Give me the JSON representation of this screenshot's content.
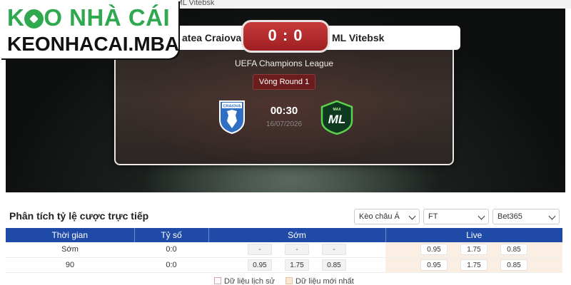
{
  "breadcrumb": "s ML Vitebsk",
  "brand": {
    "line1_prefix": "K",
    "line1_suffix": "O NHÀ CÁI",
    "line2": "KEONHACAI.MBA",
    "color": "#2fa84f"
  },
  "match": {
    "home_team": "atea Craiova",
    "away_team": "ML Vitebsk",
    "score": "0 : 0",
    "league": "UEFA Champions League",
    "round": "Vòng Round 1",
    "time": "00:30",
    "date": "16/07/2026",
    "home_crest_text": "CRAIOVA",
    "away_crest_top": "MAX",
    "away_crest_main": "ML"
  },
  "odds_panel": {
    "title": "Phân tích tỷ lệ cược trực tiếp",
    "filters": [
      "Kèo châu Á",
      "FT",
      "Bet365"
    ],
    "columns": [
      "Thời gian",
      "Tỷ số",
      "Sớm",
      "Live"
    ],
    "rows": [
      {
        "time": "Sớm",
        "score": "0:0",
        "early": [
          "-",
          "-",
          "-"
        ],
        "live": [
          "0.95",
          "1.75",
          "0.85"
        ]
      },
      {
        "time": "90",
        "score": "0:0",
        "early": [
          "0.95",
          "1.75",
          "0.85"
        ],
        "live": [
          "0.95",
          "1.75",
          "0.85"
        ]
      }
    ],
    "legend": [
      "Dữ liệu lịch sử",
      "Dữ liệu mới nhất"
    ]
  },
  "colors": {
    "table_header": "#1f4aa8",
    "score_box": "#b52a2d",
    "live_cell": "#fbeee2"
  }
}
